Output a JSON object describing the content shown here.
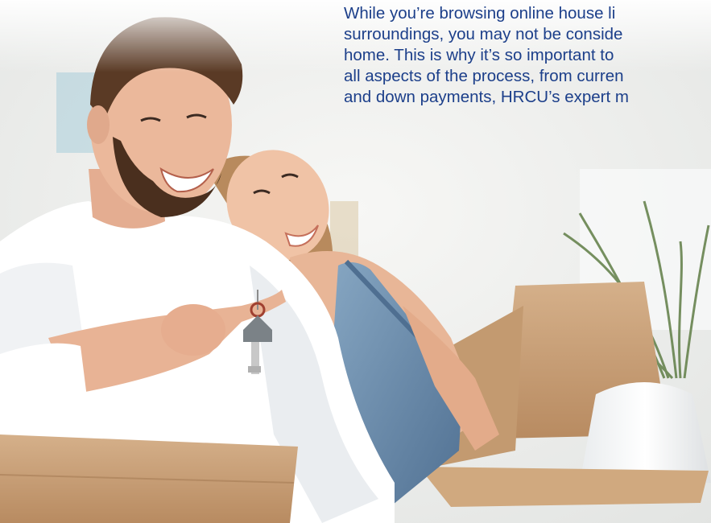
{
  "article": {
    "lines": [
      "While you’re browsing online house li",
      "surroundings, you may not be conside",
      "home. This is why it’s so important to",
      "all aspects of the process, from curren",
      "and down payments, HRCU’s expert m"
    ]
  },
  "photo": {
    "subject": "couple-with-house-key-and-moving-boxes",
    "colors": {
      "wall": "#eef0ef",
      "shirt": "#ffffff",
      "skin": "#e7b398",
      "hair": "#5a3a25",
      "box": "#c9a27a",
      "box_dark": "#a77d56",
      "denim": "#6e8fae",
      "plant": "#5f7d45",
      "text": "#1c3f8a"
    }
  }
}
